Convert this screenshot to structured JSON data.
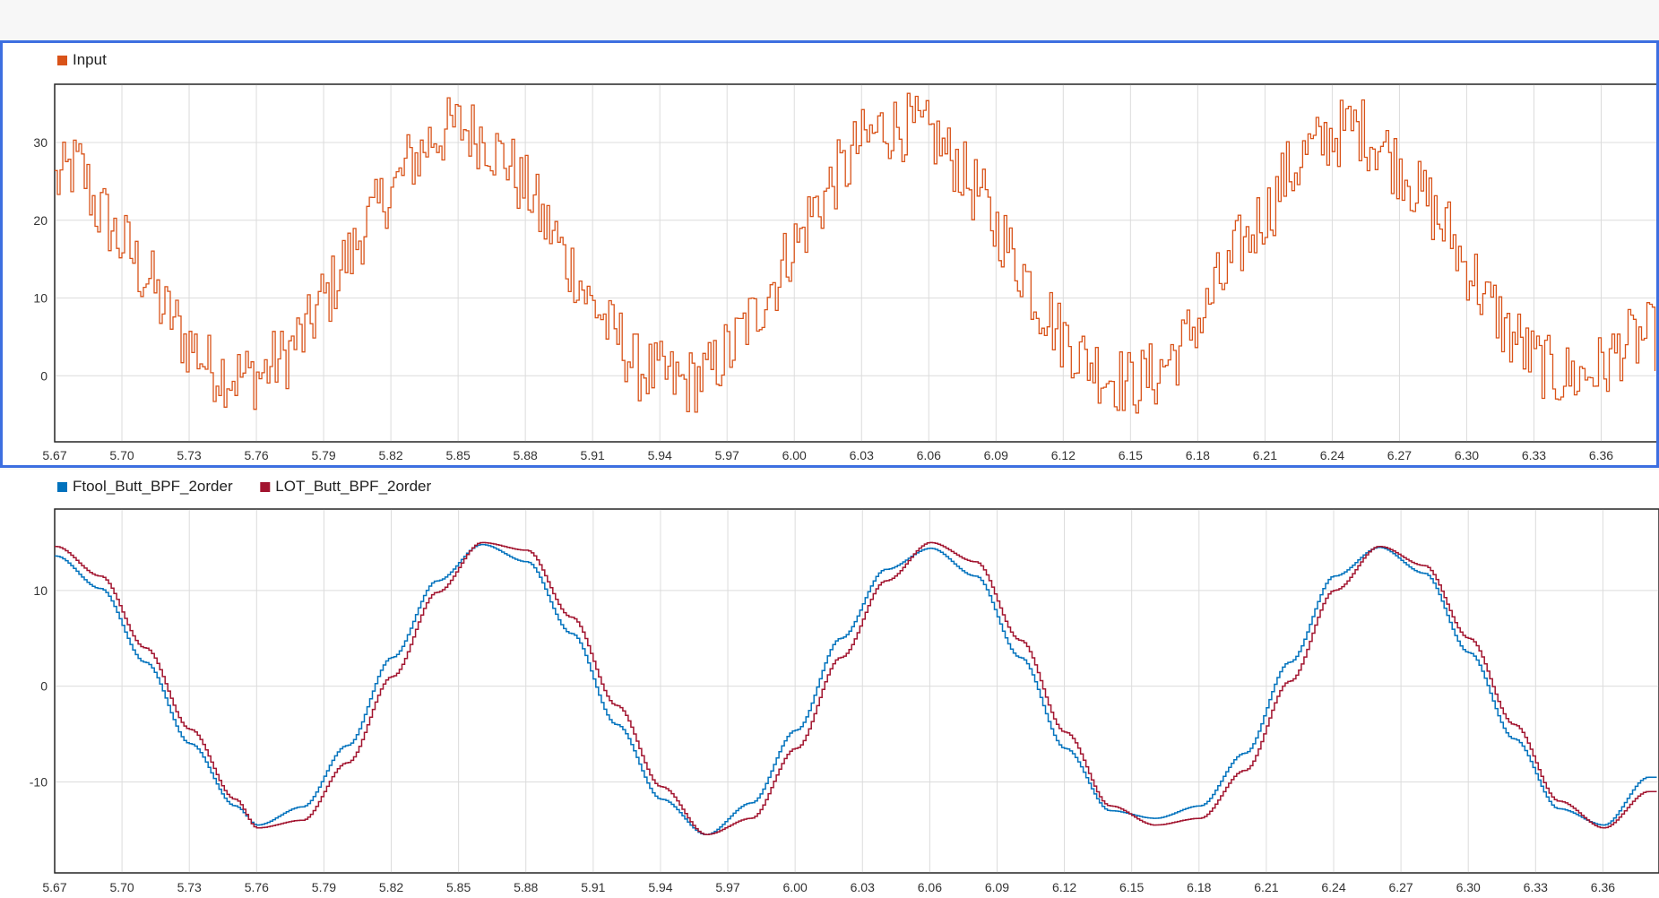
{
  "chart_data": [
    {
      "type": "line",
      "title": "",
      "xlabel": "",
      "ylabel": "",
      "xlim": [
        5.67,
        6.385
      ],
      "ylim": [
        -8.5,
        37.5
      ],
      "x_ticks": [
        "5.67",
        "5.70",
        "5.73",
        "5.76",
        "5.79",
        "5.82",
        "5.85",
        "5.88",
        "5.91",
        "5.94",
        "5.97",
        "6.00",
        "6.03",
        "6.06",
        "6.09",
        "6.12",
        "6.15",
        "6.18",
        "6.21",
        "6.24",
        "6.27",
        "6.30",
        "6.33",
        "6.36"
      ],
      "y_ticks": [
        "0",
        "10",
        "20",
        "30"
      ],
      "grid": true,
      "legend_position": "top-left",
      "series": [
        {
          "name": "Input",
          "color": "#d95319",
          "style": "stairs",
          "description_values": "noisy sinusoid, centre ~15, amplitude ~15, period ~0.2, noise ~±4",
          "x": [
            5.67,
            5.68,
            5.69,
            5.7,
            5.71,
            5.72,
            5.73,
            5.74,
            5.75,
            5.76,
            5.77,
            5.78,
            5.79,
            5.8,
            5.81,
            5.82,
            5.83,
            5.84,
            5.85,
            5.86,
            5.87,
            5.88,
            5.89,
            5.9,
            5.91,
            5.92,
            5.93,
            5.94,
            5.95,
            5.96,
            5.97,
            5.98,
            5.99,
            6.0,
            6.01,
            6.02,
            6.03,
            6.04,
            6.05,
            6.06,
            6.07,
            6.08,
            6.09,
            6.1,
            6.11,
            6.12,
            6.13,
            6.14,
            6.15,
            6.16,
            6.17,
            6.18,
            6.19,
            6.2,
            6.21,
            6.22,
            6.23,
            6.24,
            6.25,
            6.26,
            6.27,
            6.28,
            6.29,
            6.3,
            6.31,
            6.32,
            6.33,
            6.34,
            6.35,
            6.36,
            6.37,
            6.38
          ],
          "y": [
            25,
            27,
            21,
            17,
            13,
            8,
            4,
            1,
            0,
            0,
            2,
            5,
            10,
            15,
            20,
            24,
            28,
            31,
            32,
            31,
            28,
            24,
            19,
            14,
            9,
            5,
            1,
            0,
            -1,
            0,
            3,
            7,
            12,
            17,
            22,
            26,
            30,
            32,
            32,
            31,
            28,
            24,
            19,
            14,
            9,
            5,
            2,
            0,
            -1,
            0,
            3,
            7,
            12,
            17,
            21,
            26,
            29,
            31,
            32,
            30,
            27,
            23,
            19,
            14,
            9,
            5,
            2,
            0,
            0,
            1,
            4,
            5
          ]
        }
      ]
    },
    {
      "type": "line",
      "title": "",
      "xlabel": "",
      "ylabel": "",
      "xlim": [
        5.67,
        6.385
      ],
      "ylim": [
        -19.5,
        18.5
      ],
      "x_ticks": [
        "5.67",
        "5.70",
        "5.73",
        "5.76",
        "5.79",
        "5.82",
        "5.85",
        "5.88",
        "5.91",
        "5.94",
        "5.97",
        "6.00",
        "6.03",
        "6.06",
        "6.09",
        "6.12",
        "6.15",
        "6.18",
        "6.21",
        "6.24",
        "6.27",
        "6.30",
        "6.33",
        "6.36"
      ],
      "y_ticks": [
        "-10",
        "0",
        "10"
      ],
      "grid": true,
      "legend_position": "top-left",
      "series": [
        {
          "name": "Ftool_Butt_BPF_2order",
          "color": "#0072bd",
          "style": "stairs",
          "x": [
            5.67,
            5.69,
            5.71,
            5.73,
            5.75,
            5.76,
            5.78,
            5.8,
            5.82,
            5.84,
            5.86,
            5.88,
            5.9,
            5.92,
            5.94,
            5.96,
            5.98,
            6.0,
            6.02,
            6.04,
            6.06,
            6.08,
            6.1,
            6.12,
            6.14,
            6.16,
            6.18,
            6.2,
            6.22,
            6.24,
            6.26,
            6.28,
            6.3,
            6.32,
            6.34,
            6.36,
            6.38
          ],
          "y": [
            13.6,
            10.2,
            2.5,
            -6.0,
            -12.5,
            -14.5,
            -12.6,
            -6.2,
            3.0,
            11.0,
            14.8,
            13.0,
            5.5,
            -4.0,
            -11.8,
            -15.5,
            -12.2,
            -4.6,
            5.0,
            12.2,
            14.4,
            11.5,
            3.0,
            -6.5,
            -13.0,
            -13.8,
            -12.5,
            -7.0,
            2.5,
            11.5,
            14.5,
            11.8,
            3.5,
            -5.5,
            -12.8,
            -14.5,
            -9.5
          ]
        },
        {
          "name": "LOT_Butt_BPF_2order",
          "color": "#a2142f",
          "style": "stairs",
          "x": [
            5.67,
            5.69,
            5.71,
            5.73,
            5.75,
            5.76,
            5.78,
            5.8,
            5.82,
            5.84,
            5.86,
            5.88,
            5.9,
            5.92,
            5.94,
            5.96,
            5.98,
            6.0,
            6.02,
            6.04,
            6.06,
            6.08,
            6.1,
            6.12,
            6.14,
            6.16,
            6.18,
            6.2,
            6.22,
            6.24,
            6.26,
            6.28,
            6.3,
            6.32,
            6.34,
            6.36,
            6.38
          ],
          "y": [
            14.6,
            11.5,
            4.0,
            -4.5,
            -11.8,
            -14.8,
            -14.0,
            -8.0,
            1.0,
            9.8,
            15.0,
            14.2,
            7.2,
            -2.0,
            -10.5,
            -15.5,
            -13.8,
            -6.5,
            3.0,
            11.0,
            15.0,
            13.0,
            4.8,
            -4.8,
            -12.5,
            -14.5,
            -13.8,
            -8.8,
            0.5,
            10.0,
            14.6,
            12.6,
            5.0,
            -4.0,
            -12.0,
            -14.8,
            -11.0
          ]
        }
      ]
    }
  ]
}
